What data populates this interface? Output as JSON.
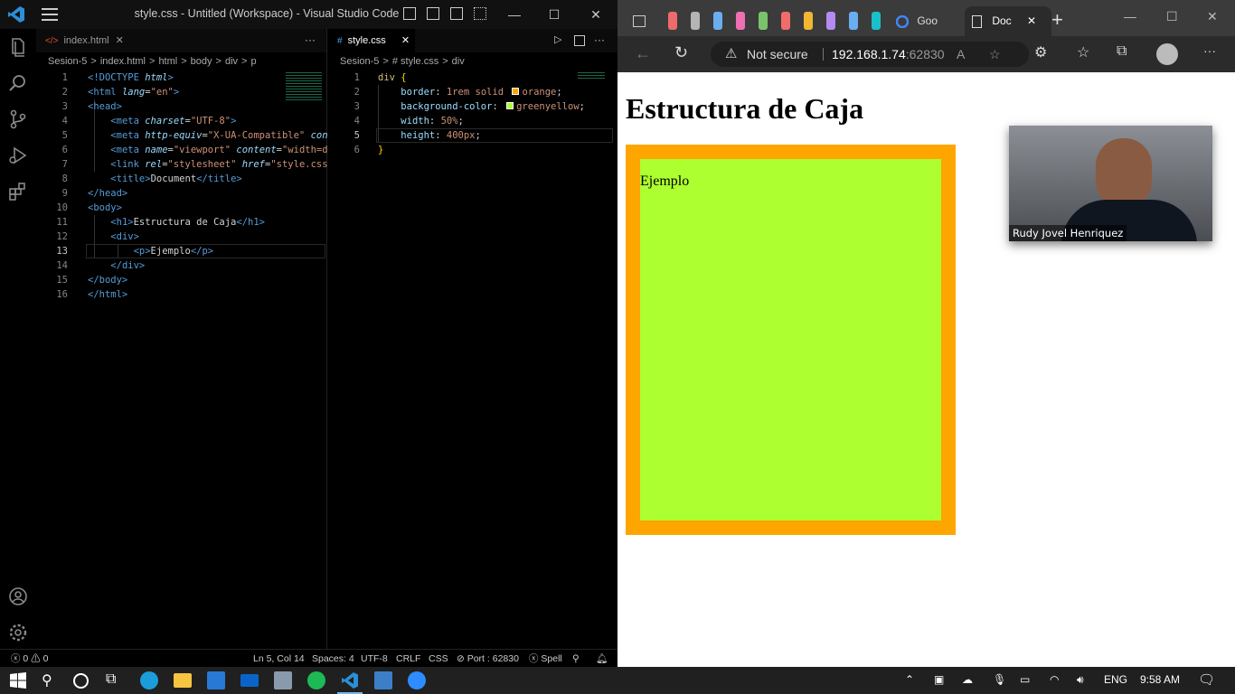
{
  "vscode": {
    "title": "style.css - Untitled (Workspace) - Visual Studio Code",
    "left_tab": "index.html",
    "right_tab": "style.css",
    "left_crumbs": [
      "Sesion-5",
      ">",
      "index.html",
      ">",
      "html",
      ">",
      "body",
      ">",
      "div",
      ">",
      "p"
    ],
    "right_crumbs": [
      "Sesion-5",
      ">",
      "# style.css",
      ">",
      "div"
    ],
    "html_lines": [
      {
        "n": "1",
        "t": [
          [
            "t",
            "<!DOCTYPE "
          ],
          [
            "a",
            "html"
          ],
          [
            "t",
            ">"
          ]
        ]
      },
      {
        "n": "2",
        "t": [
          [
            "t",
            "<html "
          ],
          [
            "a",
            "lang"
          ],
          [
            "w",
            "="
          ],
          [
            "s",
            "\"en\""
          ],
          [
            "t",
            ">"
          ]
        ]
      },
      {
        "n": "3",
        "t": [
          [
            "t",
            "<head>"
          ]
        ]
      },
      {
        "n": "4",
        "t": [
          [
            "w",
            "    "
          ],
          [
            "t",
            "<meta "
          ],
          [
            "a",
            "charset"
          ],
          [
            "w",
            "="
          ],
          [
            "s",
            "\"UTF-8\""
          ],
          [
            "t",
            ">"
          ]
        ]
      },
      {
        "n": "5",
        "t": [
          [
            "w",
            "    "
          ],
          [
            "t",
            "<meta "
          ],
          [
            "a",
            "http-equiv"
          ],
          [
            "w",
            "="
          ],
          [
            "s",
            "\"X-UA-Compatible\""
          ],
          [
            "w",
            " "
          ],
          [
            "a",
            "con"
          ]
        ]
      },
      {
        "n": "6",
        "t": [
          [
            "w",
            "    "
          ],
          [
            "t",
            "<meta "
          ],
          [
            "a",
            "name"
          ],
          [
            "w",
            "="
          ],
          [
            "s",
            "\"viewport\""
          ],
          [
            "w",
            " "
          ],
          [
            "a",
            "content"
          ],
          [
            "w",
            "="
          ],
          [
            "s",
            "\"width=d"
          ]
        ]
      },
      {
        "n": "7",
        "t": [
          [
            "w",
            "    "
          ],
          [
            "t",
            "<link "
          ],
          [
            "a",
            "rel"
          ],
          [
            "w",
            "="
          ],
          [
            "s",
            "\"stylesheet\""
          ],
          [
            "w",
            " "
          ],
          [
            "a",
            "href"
          ],
          [
            "w",
            "="
          ],
          [
            "s",
            "\"style.css"
          ]
        ]
      },
      {
        "n": "8",
        "t": [
          [
            "w",
            "    "
          ],
          [
            "t",
            "<title>"
          ],
          [
            "w",
            "Document"
          ],
          [
            "t",
            "</title>"
          ]
        ]
      },
      {
        "n": "9",
        "t": [
          [
            "t",
            "</head>"
          ]
        ]
      },
      {
        "n": "10",
        "t": [
          [
            "t",
            "<body>"
          ]
        ]
      },
      {
        "n": "11",
        "t": [
          [
            "w",
            "    "
          ],
          [
            "t",
            "<h1>"
          ],
          [
            "w",
            "Estructura de Caja"
          ],
          [
            "t",
            "</h1>"
          ]
        ]
      },
      {
        "n": "12",
        "t": [
          [
            "w",
            "    "
          ],
          [
            "t",
            "<div>"
          ]
        ]
      },
      {
        "n": "13",
        "t": [
          [
            "w",
            "        "
          ],
          [
            "t",
            "<p>"
          ],
          [
            "w",
            "Ejemplo"
          ],
          [
            "t",
            "</p>"
          ]
        ]
      },
      {
        "n": "14",
        "t": [
          [
            "w",
            "    "
          ],
          [
            "t",
            "</div>"
          ]
        ]
      },
      {
        "n": "15",
        "t": [
          [
            "t",
            "</body>"
          ]
        ]
      },
      {
        "n": "16",
        "t": [
          [
            "t",
            "</html>"
          ]
        ]
      }
    ],
    "css_lines": [
      {
        "n": "1",
        "t": [
          [
            "c",
            "div "
          ],
          [
            "y",
            "{"
          ]
        ]
      },
      {
        "n": "2",
        "t": [
          [
            "w",
            "    "
          ],
          [
            "a2",
            "border"
          ],
          [
            "w",
            ": "
          ],
          [
            "s",
            "1rem solid "
          ],
          [
            "sw",
            "#ffa500"
          ],
          [
            "s",
            "orange"
          ],
          [
            "w",
            ";"
          ]
        ]
      },
      {
        "n": "3",
        "t": [
          [
            "w",
            "    "
          ],
          [
            "a2",
            "background-color"
          ],
          [
            "w",
            ": "
          ],
          [
            "sw",
            "#adff2f"
          ],
          [
            "s",
            "greenyellow"
          ],
          [
            "w",
            ";"
          ]
        ]
      },
      {
        "n": "4",
        "t": [
          [
            "w",
            "    "
          ],
          [
            "a2",
            "width"
          ],
          [
            "w",
            ": "
          ],
          [
            "s",
            "50%"
          ],
          [
            "w",
            ";"
          ]
        ]
      },
      {
        "n": "5",
        "t": [
          [
            "w",
            "    "
          ],
          [
            "a2",
            "height"
          ],
          [
            "w",
            ": "
          ],
          [
            "s",
            "400px"
          ],
          [
            "w",
            ";"
          ]
        ]
      },
      {
        "n": "6",
        "t": [
          [
            "y",
            "}"
          ]
        ]
      }
    ],
    "status": {
      "problems": "ⓧ 0 ⚠ 0",
      "position": "Ln 5, Col 14",
      "spaces": "Spaces: 4",
      "encoding": "UTF-8",
      "eol": "CRLF",
      "lang": "CSS",
      "port": "⊘ Port : 62830",
      "spell": "ⓧ Spell"
    }
  },
  "browser": {
    "tab_google": "Goo",
    "tab_doc": "Doc",
    "security": "Not secure",
    "url_host": "192.168.1.74",
    "url_port": ":62830",
    "page_title": "Estructura de Caja",
    "paragraph": "Ejemplo",
    "box": {
      "border_color": "#ffa500",
      "bg_color": "#adff2f"
    },
    "camera_name": "Rudy Jovel Henriquez"
  },
  "taskbar": {
    "lang": "ENG",
    "time": "9:58 AM"
  }
}
